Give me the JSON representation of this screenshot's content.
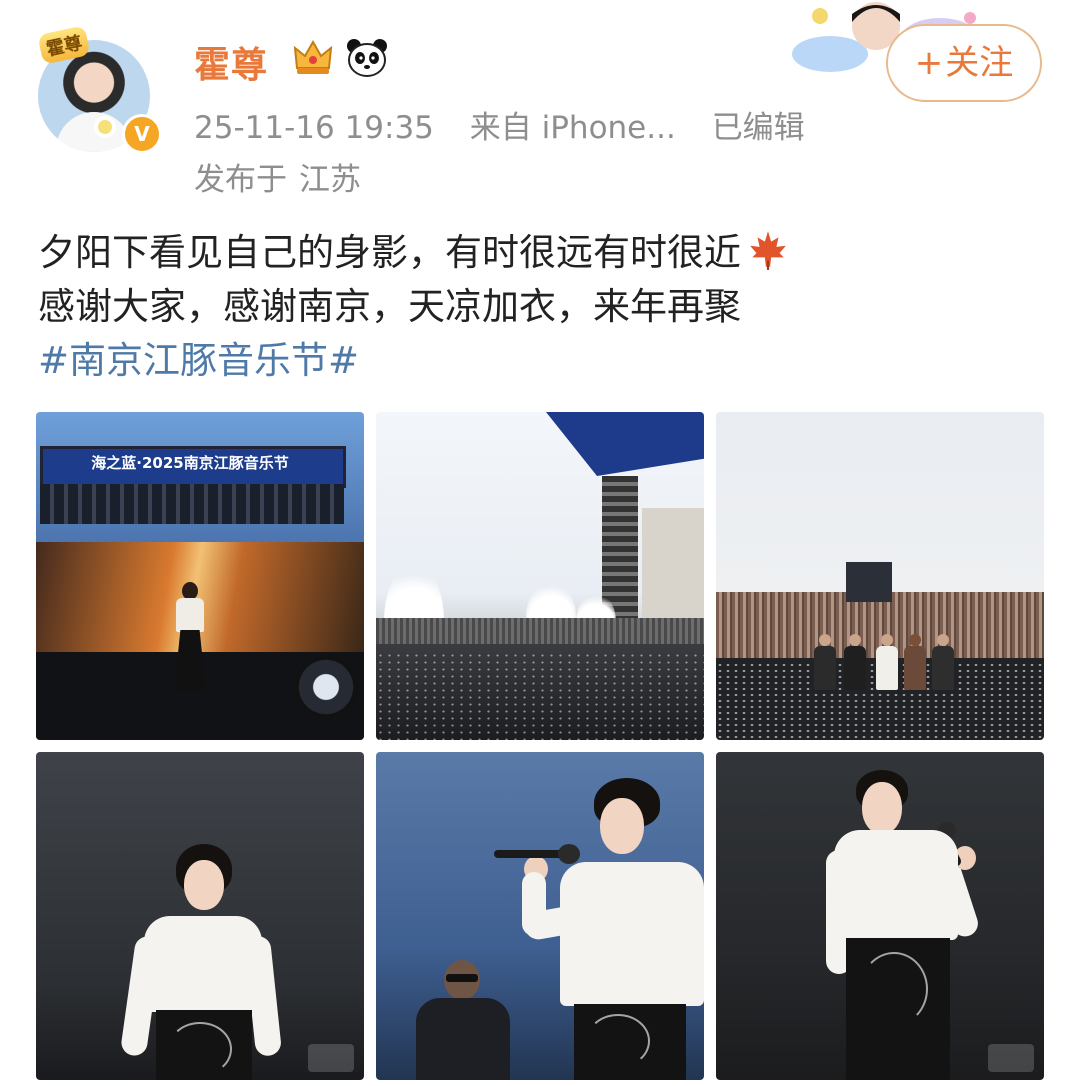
{
  "header": {
    "avatar_badge_text": "霍尊",
    "username": "霍尊",
    "verified_icon": "verified-v-icon",
    "badges": [
      "crown-icon",
      "panda-icon"
    ],
    "timestamp": "25-11-16 19:35",
    "source": "来自 iPhone...",
    "edited": "已编辑",
    "location_prefix": "发布于",
    "location": "江苏",
    "follow_label": "关注",
    "follow_plus": "+"
  },
  "post": {
    "line1": "夕阳下看见自己的身影，有时很远有时很近",
    "line1_emoji": "maple-leaf-icon",
    "line2": "感谢大家，感谢南京，天凉加衣，来年再聚",
    "hashtag": "#南京江豚音乐节#"
  },
  "photos": {
    "count": 6,
    "photo1_banner": "海之蓝·2025南京江豚音乐节"
  },
  "colors": {
    "username": "#e8793a",
    "meta": "#8e8e8e",
    "hashtag": "#4f7aa8",
    "follow_border": "#e9b98e",
    "verified": "#f5a623"
  }
}
